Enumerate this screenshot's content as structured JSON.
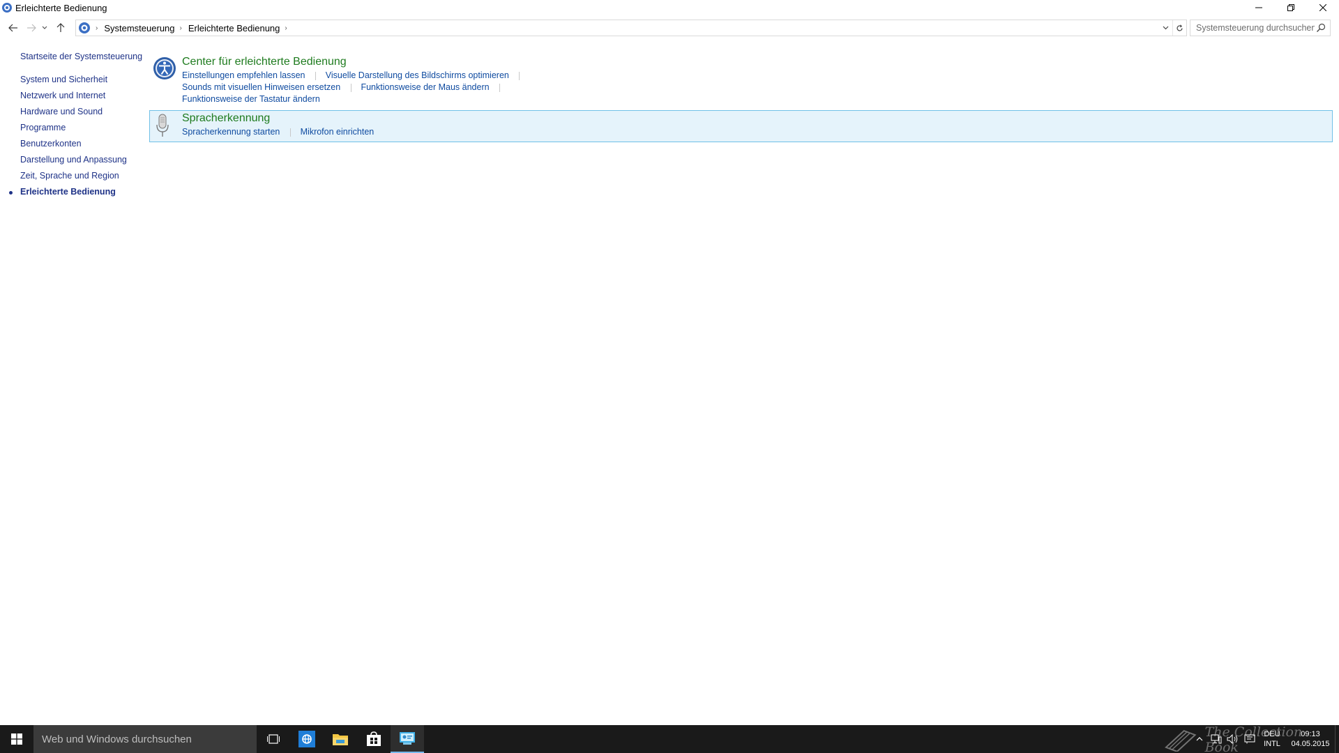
{
  "window": {
    "title": "Erleichterte Bedienung",
    "icon": "control-panel-icon",
    "controls": [
      "minimize-icon",
      "restore-icon",
      "close-icon"
    ]
  },
  "navigation": {
    "back_icon": "arrow-left-icon",
    "forward_icon": "arrow-right-icon",
    "recent_icon": "chevron-down-icon",
    "up_icon": "arrow-up-icon",
    "breadcrumb": [
      "Systemsteuerung",
      "Erleichterte Bedienung"
    ],
    "search_placeholder": "Systemsteuerung durchsuchen"
  },
  "sidebar": {
    "home": "Startseite der Systemsteuerung",
    "items": [
      {
        "label": "System und Sicherheit"
      },
      {
        "label": "Netzwerk und Internet"
      },
      {
        "label": "Hardware und Sound"
      },
      {
        "label": "Programme"
      },
      {
        "label": "Benutzerkonten"
      },
      {
        "label": "Darstellung und Anpassung"
      },
      {
        "label": "Zeit, Sprache und Region"
      },
      {
        "label": "Erleichterte Bedienung",
        "active": true
      }
    ]
  },
  "sections": [
    {
      "title": "Center für erleichterte Bedienung",
      "icon": "ease-of-access-icon",
      "links": [
        "Einstellungen empfehlen lassen",
        "Visuelle Darstellung des Bildschirms optimieren",
        "Sounds mit visuellen Hinweisen ersetzen",
        "Funktionsweise der Maus ändern",
        "Funktionsweise der Tastatur ändern"
      ]
    },
    {
      "title": "Spracherkennung",
      "icon": "microphone-icon",
      "highlighted": true,
      "links": [
        "Spracherkennung starten",
        "Mikrofon einrichten"
      ]
    }
  ],
  "taskbar": {
    "search_placeholder": "Web und Windows durchsuchen",
    "apps": [
      "task-view-icon",
      "internet-explorer-icon",
      "file-explorer-icon",
      "store-icon",
      "control-panel-icon"
    ],
    "tray": {
      "language_top": "DEU",
      "language_bottom": "INTL",
      "time": "09:13",
      "date": "04.05.2015"
    },
    "watermark": "The Collection Book"
  },
  "colors": {
    "link": "#0f4ba0",
    "section_title": "#1e7b1e",
    "nav_link": "#1e3287",
    "highlight_bg": "#e5f3fb",
    "highlight_border": "#70c0e7",
    "taskbar": "#1a1a1a"
  }
}
